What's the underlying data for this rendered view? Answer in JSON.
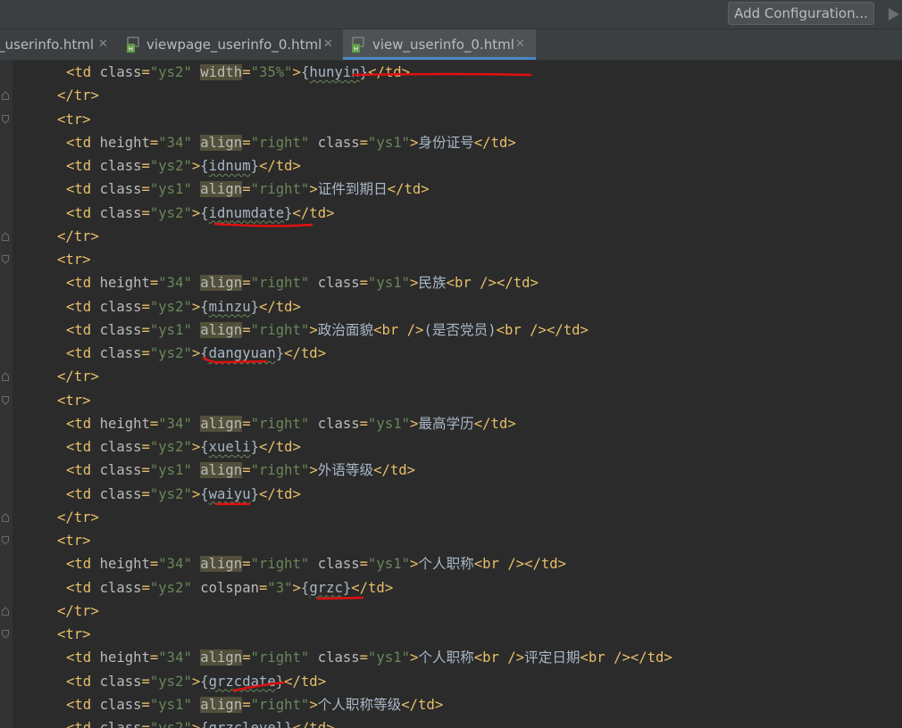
{
  "toolbar": {
    "run_configuration_label": "Add Configuration..."
  },
  "tabs": [
    {
      "label": "_userinfo.html",
      "active": false
    },
    {
      "label": "viewpage_userinfo_0.html",
      "active": false
    },
    {
      "label": "view_userinfo_0.html",
      "active": true
    }
  ],
  "editor": {
    "lines": [
      {
        "indent": "  ",
        "tokens": [
          [
            "t",
            "<td "
          ],
          [
            "a",
            "class"
          ],
          [
            "t",
            "="
          ],
          [
            "v",
            "\"ys2\""
          ],
          [
            "x",
            " "
          ],
          [
            "ah",
            "width"
          ],
          [
            "t",
            "="
          ],
          [
            "v",
            "\"35%\""
          ],
          [
            "t",
            ">"
          ],
          [
            "x",
            "{"
          ],
          [
            "e",
            "hunyin"
          ],
          [
            "x",
            "}"
          ],
          [
            "t",
            "</td>"
          ]
        ]
      },
      {
        "indent": " ",
        "tokens": [
          [
            "t",
            "</tr>"
          ]
        ]
      },
      {
        "indent": " ",
        "tokens": [
          [
            "t",
            "<tr>"
          ]
        ]
      },
      {
        "indent": "  ",
        "tokens": [
          [
            "t",
            "<td "
          ],
          [
            "a",
            "height"
          ],
          [
            "t",
            "="
          ],
          [
            "v",
            "\"34\""
          ],
          [
            "x",
            " "
          ],
          [
            "ah",
            "align"
          ],
          [
            "t",
            "="
          ],
          [
            "v",
            "\"right\""
          ],
          [
            "x",
            " "
          ],
          [
            "a",
            "class"
          ],
          [
            "t",
            "="
          ],
          [
            "v",
            "\"ys1\""
          ],
          [
            "t",
            ">"
          ],
          [
            "x",
            "身份证号"
          ],
          [
            "t",
            "</td>"
          ]
        ]
      },
      {
        "indent": "  ",
        "tokens": [
          [
            "t",
            "<td "
          ],
          [
            "a",
            "class"
          ],
          [
            "t",
            "="
          ],
          [
            "v",
            "\"ys2\""
          ],
          [
            "t",
            ">"
          ],
          [
            "x",
            "{"
          ],
          [
            "e",
            "idnum"
          ],
          [
            "x",
            "}"
          ],
          [
            "t",
            "</td>"
          ]
        ]
      },
      {
        "indent": "  ",
        "tokens": [
          [
            "t",
            "<td "
          ],
          [
            "a",
            "class"
          ],
          [
            "t",
            "="
          ],
          [
            "v",
            "\"ys1\""
          ],
          [
            "x",
            " "
          ],
          [
            "ah",
            "align"
          ],
          [
            "t",
            "="
          ],
          [
            "v",
            "\"right\""
          ],
          [
            "t",
            ">"
          ],
          [
            "x",
            "证件到期日"
          ],
          [
            "t",
            "</td>"
          ]
        ]
      },
      {
        "indent": "  ",
        "tokens": [
          [
            "t",
            "<td "
          ],
          [
            "a",
            "class"
          ],
          [
            "t",
            "="
          ],
          [
            "v",
            "\"ys2\""
          ],
          [
            "t",
            ">"
          ],
          [
            "x",
            "{"
          ],
          [
            "e",
            "idnumdate"
          ],
          [
            "x",
            "}"
          ],
          [
            "t",
            "</td>"
          ]
        ]
      },
      {
        "indent": " ",
        "tokens": [
          [
            "t",
            "</tr>"
          ]
        ]
      },
      {
        "indent": " ",
        "tokens": [
          [
            "t",
            "<tr>"
          ]
        ]
      },
      {
        "indent": "  ",
        "tokens": [
          [
            "t",
            "<td "
          ],
          [
            "a",
            "height"
          ],
          [
            "t",
            "="
          ],
          [
            "v",
            "\"34\""
          ],
          [
            "x",
            " "
          ],
          [
            "ah",
            "align"
          ],
          [
            "t",
            "="
          ],
          [
            "v",
            "\"right\""
          ],
          [
            "x",
            " "
          ],
          [
            "a",
            "class"
          ],
          [
            "t",
            "="
          ],
          [
            "v",
            "\"ys1\""
          ],
          [
            "t",
            ">"
          ],
          [
            "x",
            "民族"
          ],
          [
            "t",
            "<br />"
          ],
          [
            "t",
            "</td>"
          ]
        ]
      },
      {
        "indent": "  ",
        "tokens": [
          [
            "t",
            "<td "
          ],
          [
            "a",
            "class"
          ],
          [
            "t",
            "="
          ],
          [
            "v",
            "\"ys2\""
          ],
          [
            "t",
            ">"
          ],
          [
            "x",
            "{"
          ],
          [
            "e",
            "minzu"
          ],
          [
            "x",
            "}"
          ],
          [
            "t",
            "</td>"
          ]
        ]
      },
      {
        "indent": "  ",
        "tokens": [
          [
            "t",
            "<td "
          ],
          [
            "a",
            "class"
          ],
          [
            "t",
            "="
          ],
          [
            "v",
            "\"ys1\""
          ],
          [
            "x",
            " "
          ],
          [
            "ah",
            "align"
          ],
          [
            "t",
            "="
          ],
          [
            "v",
            "\"right\""
          ],
          [
            "t",
            ">"
          ],
          [
            "x",
            "政治面貌"
          ],
          [
            "t",
            "<br />"
          ],
          [
            "x",
            "(是否党员)"
          ],
          [
            "t",
            "<br />"
          ],
          [
            "t",
            "</td>"
          ]
        ]
      },
      {
        "indent": "  ",
        "tokens": [
          [
            "t",
            "<td "
          ],
          [
            "a",
            "class"
          ],
          [
            "t",
            "="
          ],
          [
            "v",
            "\"ys2\""
          ],
          [
            "t",
            ">"
          ],
          [
            "x",
            "{"
          ],
          [
            "e",
            "dangyuan"
          ],
          [
            "x",
            "}"
          ],
          [
            "t",
            "</td>"
          ]
        ]
      },
      {
        "indent": " ",
        "tokens": [
          [
            "t",
            "</tr>"
          ]
        ]
      },
      {
        "indent": " ",
        "tokens": [
          [
            "t",
            "<tr>"
          ]
        ]
      },
      {
        "indent": "  ",
        "tokens": [
          [
            "t",
            "<td "
          ],
          [
            "a",
            "height"
          ],
          [
            "t",
            "="
          ],
          [
            "v",
            "\"34\""
          ],
          [
            "x",
            " "
          ],
          [
            "ah",
            "align"
          ],
          [
            "t",
            "="
          ],
          [
            "v",
            "\"right\""
          ],
          [
            "x",
            " "
          ],
          [
            "a",
            "class"
          ],
          [
            "t",
            "="
          ],
          [
            "v",
            "\"ys1\""
          ],
          [
            "t",
            ">"
          ],
          [
            "x",
            "最高学历"
          ],
          [
            "t",
            "</td>"
          ]
        ]
      },
      {
        "indent": "  ",
        "tokens": [
          [
            "t",
            "<td "
          ],
          [
            "a",
            "class"
          ],
          [
            "t",
            "="
          ],
          [
            "v",
            "\"ys2\""
          ],
          [
            "t",
            ">"
          ],
          [
            "x",
            "{"
          ],
          [
            "e",
            "xueli"
          ],
          [
            "x",
            "}"
          ],
          [
            "t",
            "</td>"
          ]
        ]
      },
      {
        "indent": "  ",
        "tokens": [
          [
            "t",
            "<td "
          ],
          [
            "a",
            "class"
          ],
          [
            "t",
            "="
          ],
          [
            "v",
            "\"ys1\""
          ],
          [
            "x",
            " "
          ],
          [
            "ah",
            "align"
          ],
          [
            "t",
            "="
          ],
          [
            "v",
            "\"right\""
          ],
          [
            "t",
            ">"
          ],
          [
            "x",
            "外语等级"
          ],
          [
            "t",
            "</td>"
          ]
        ]
      },
      {
        "indent": "  ",
        "tokens": [
          [
            "t",
            "<td "
          ],
          [
            "a",
            "class"
          ],
          [
            "t",
            "="
          ],
          [
            "v",
            "\"ys2\""
          ],
          [
            "t",
            ">"
          ],
          [
            "x",
            "{"
          ],
          [
            "e",
            "waiyu"
          ],
          [
            "x",
            "}"
          ],
          [
            "t",
            "</td>"
          ]
        ]
      },
      {
        "indent": " ",
        "tokens": [
          [
            "t",
            "</tr>"
          ]
        ]
      },
      {
        "indent": " ",
        "tokens": [
          [
            "t",
            "<tr>"
          ]
        ]
      },
      {
        "indent": "  ",
        "tokens": [
          [
            "t",
            "<td "
          ],
          [
            "a",
            "height"
          ],
          [
            "t",
            "="
          ],
          [
            "v",
            "\"34\""
          ],
          [
            "x",
            " "
          ],
          [
            "ah",
            "align"
          ],
          [
            "t",
            "="
          ],
          [
            "v",
            "\"right\""
          ],
          [
            "x",
            " "
          ],
          [
            "a",
            "class"
          ],
          [
            "t",
            "="
          ],
          [
            "v",
            "\"ys1\""
          ],
          [
            "t",
            ">"
          ],
          [
            "x",
            "个人职称"
          ],
          [
            "t",
            "<br />"
          ],
          [
            "t",
            "</td>"
          ]
        ]
      },
      {
        "indent": "  ",
        "tokens": [
          [
            "t",
            "<td "
          ],
          [
            "a",
            "class"
          ],
          [
            "t",
            "="
          ],
          [
            "v",
            "\"ys2\""
          ],
          [
            "x",
            " "
          ],
          [
            "a",
            "colspan"
          ],
          [
            "t",
            "="
          ],
          [
            "v",
            "\"3\""
          ],
          [
            "t",
            ">"
          ],
          [
            "x",
            "{"
          ],
          [
            "e",
            "grzc"
          ],
          [
            "x",
            "}"
          ],
          [
            "t",
            "</td>"
          ]
        ]
      },
      {
        "indent": " ",
        "tokens": [
          [
            "t",
            "</tr>"
          ]
        ]
      },
      {
        "indent": " ",
        "tokens": [
          [
            "t",
            "<tr>"
          ]
        ]
      },
      {
        "indent": "  ",
        "tokens": [
          [
            "t",
            "<td "
          ],
          [
            "a",
            "height"
          ],
          [
            "t",
            "="
          ],
          [
            "v",
            "\"34\""
          ],
          [
            "x",
            " "
          ],
          [
            "ah",
            "align"
          ],
          [
            "t",
            "="
          ],
          [
            "v",
            "\"right\""
          ],
          [
            "x",
            " "
          ],
          [
            "a",
            "class"
          ],
          [
            "t",
            "="
          ],
          [
            "v",
            "\"ys1\""
          ],
          [
            "t",
            ">"
          ],
          [
            "x",
            "个人职称"
          ],
          [
            "t",
            "<br />"
          ],
          [
            "x",
            "评定日期"
          ],
          [
            "t",
            "<br />"
          ],
          [
            "t",
            "</td>"
          ]
        ]
      },
      {
        "indent": "  ",
        "tokens": [
          [
            "t",
            "<td "
          ],
          [
            "a",
            "class"
          ],
          [
            "t",
            "="
          ],
          [
            "v",
            "\"ys2\""
          ],
          [
            "t",
            ">"
          ],
          [
            "x",
            "{"
          ],
          [
            "e",
            "grzcdate"
          ],
          [
            "x",
            "}"
          ],
          [
            "t",
            "</td>"
          ]
        ]
      },
      {
        "indent": "  ",
        "tokens": [
          [
            "t",
            "<td "
          ],
          [
            "a",
            "class"
          ],
          [
            "t",
            "="
          ],
          [
            "v",
            "\"ys1\""
          ],
          [
            "x",
            " "
          ],
          [
            "ah",
            "align"
          ],
          [
            "t",
            "="
          ],
          [
            "v",
            "\"right\""
          ],
          [
            "t",
            ">"
          ],
          [
            "x",
            "个人职称等级"
          ],
          [
            "t",
            "</td>"
          ]
        ]
      },
      {
        "indent": "  ",
        "tokens": [
          [
            "t",
            "<td "
          ],
          [
            "a",
            "class"
          ],
          [
            "t",
            "="
          ],
          [
            "v",
            "\"ys2\""
          ],
          [
            "t",
            ">"
          ],
          [
            "x",
            "{"
          ],
          [
            "e",
            "grzclevel"
          ],
          [
            "x",
            "}"
          ],
          [
            "t",
            "</td>"
          ]
        ]
      }
    ]
  },
  "colors": {
    "tag": "#e8bf6a",
    "attribute": "#bababa",
    "value": "#6a8759",
    "text": "#a9b7c6",
    "attribute_highlight": "#52503a",
    "annotation": "#e01010"
  }
}
